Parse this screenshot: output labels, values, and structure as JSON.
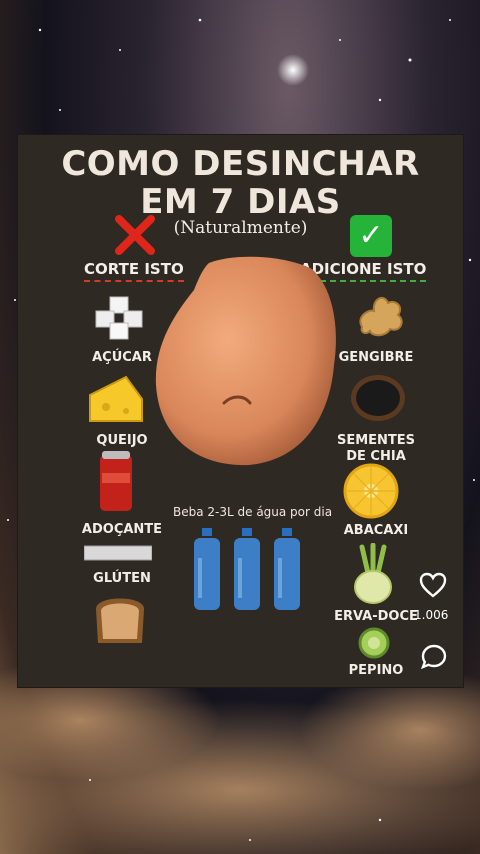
{
  "post": {
    "title_line1": "COMO DESINCHAR",
    "title_line2": "EM 7 DIAS",
    "subtitle": "(Naturalmente)",
    "left_header": "CORTE ISTO",
    "right_header": "ADICIONE ISTO",
    "left_items": [
      "AÇÚCAR",
      "QUEIJO",
      "ADOÇANTE",
      "GLÚTEN"
    ],
    "right_items": [
      "GENGIBRE",
      "SEMENTES DE CHIA",
      "ABACAXI",
      "ERVA-DOCE",
      "PEPINO"
    ],
    "water_text": "Beba 2-3L de água por dia"
  },
  "actions": {
    "like_count": "1.006",
    "like_icon": "heart-icon",
    "comment_icon": "comment-icon"
  },
  "colors": {
    "card_bg": "#2f2923",
    "cut_accent": "#d23a2a",
    "add_accent": "#3fae3f"
  }
}
